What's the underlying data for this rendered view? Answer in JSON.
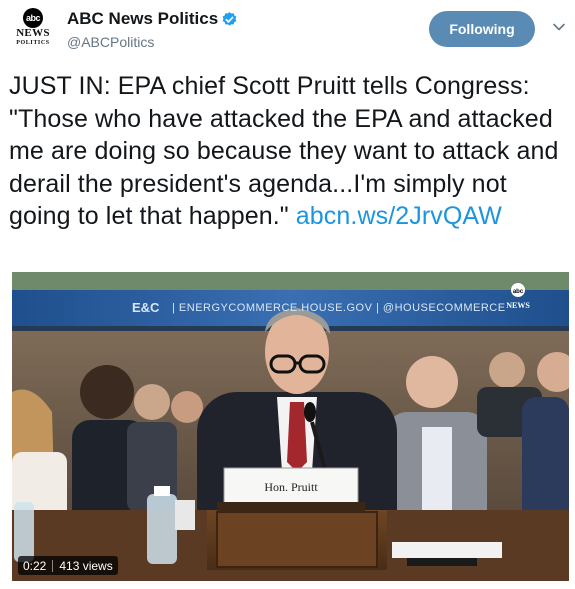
{
  "account": {
    "avatar_logo": "abc",
    "avatar_line1": "NEWS",
    "avatar_line2": "POLITICS",
    "name": "ABC News Politics",
    "handle": "@ABCPolitics",
    "verified_icon": "verified-badge-icon"
  },
  "follow_button": {
    "label": "Following"
  },
  "menu_icon": "chevron-down-icon",
  "tweet": {
    "text": "JUST IN: EPA chief Scott Pruitt tells Congress: \"Those who have attacked the EPA and attacked me are doing so because they want to attack and derail the president's agenda...I'm simply not going to let that happen.\" ",
    "link": "abcn.ws/2JrvQAW"
  },
  "video": {
    "banner_logo": "E&C",
    "banner_text": "|  ENERGYCOMMERCE.HOUSE.GOV  |  @HOUSECOMMERCE",
    "corner_logo_top": "abc",
    "corner_logo_bottom": "NEWS",
    "nameplate": "Hon. Pruitt",
    "time": "0:22",
    "views": "413 views"
  },
  "colors": {
    "button": "#5a8bb4",
    "link": "#1b95e0",
    "verified": "#1da1f2",
    "banner": "#2a5d9c"
  }
}
